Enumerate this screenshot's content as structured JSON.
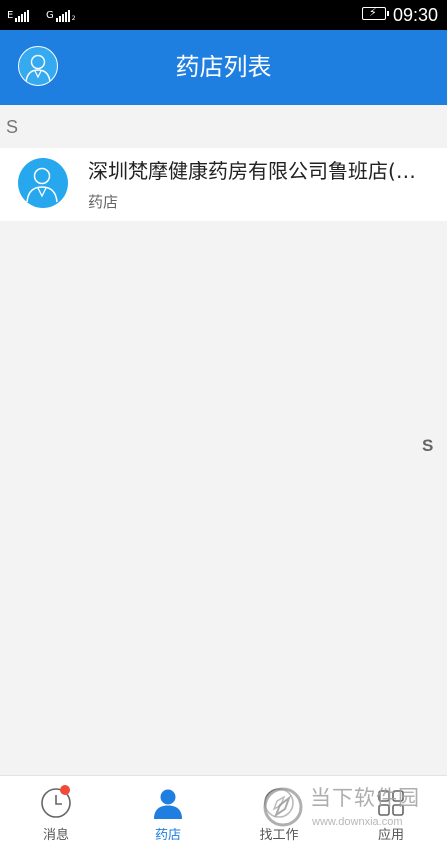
{
  "status_bar": {
    "sim1_network": "E",
    "sim2_network": "G",
    "sim2_sub": "2",
    "time": "09:30"
  },
  "header": {
    "title": "药店列表"
  },
  "list": {
    "section_letter": "S",
    "items": [
      {
        "name": "深圳梵摩健康药房有限公司鲁班店(鲁班大厦店)",
        "type": "药店"
      }
    ]
  },
  "side_index": {
    "letters": [
      "S"
    ]
  },
  "tab_bar": {
    "tabs": [
      {
        "label": "消息",
        "icon": "clock-icon",
        "badge": true
      },
      {
        "label": "药店",
        "icon": "person-icon",
        "active": true
      },
      {
        "label": "找工作",
        "icon": "compass-icon"
      },
      {
        "label": "应用",
        "icon": "grid-icon"
      }
    ]
  },
  "watermark": {
    "text": "当下软件园",
    "url": "www.downxia.com"
  },
  "colors": {
    "primary": "#1e7fe0",
    "avatar": "#27a8ee",
    "badge": "#f04a3a",
    "background": "#f3f3f3"
  }
}
